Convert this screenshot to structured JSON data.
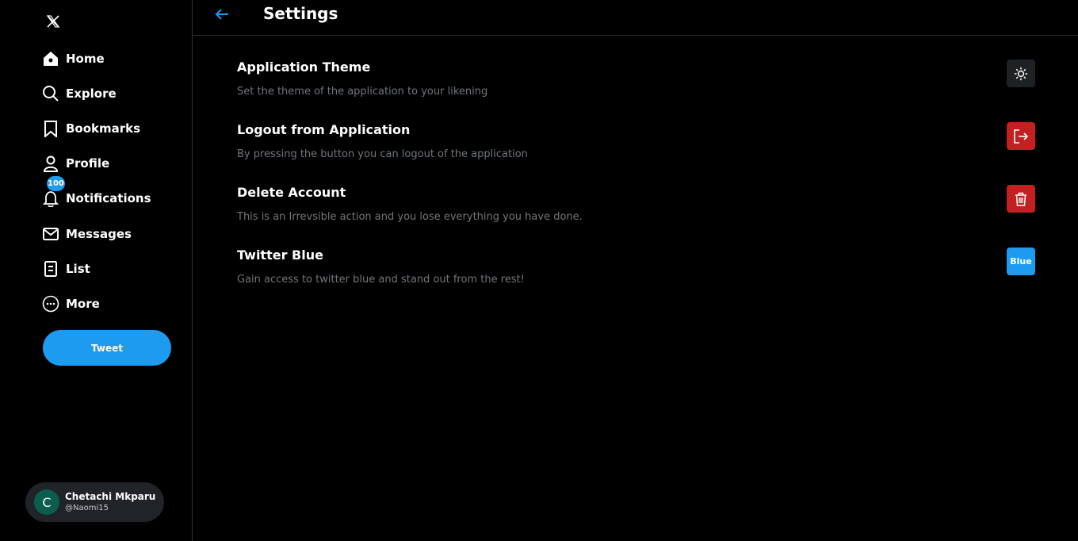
{
  "colors": {
    "accent": "#1d9bf0",
    "danger": "#c22021",
    "neutral_button": "#1f2225",
    "background": "#000000",
    "muted_text": "#71767b"
  },
  "sidebar": {
    "logo_icon": "x-logo-icon",
    "items": [
      {
        "label": "Home",
        "icon": "home-icon"
      },
      {
        "label": "Explore",
        "icon": "search-icon"
      },
      {
        "label": "Bookmarks",
        "icon": "bookmark-icon"
      },
      {
        "label": "Profile",
        "icon": "person-icon"
      },
      {
        "label": "Notifications",
        "icon": "bell-icon",
        "badge": "100"
      },
      {
        "label": "Messages",
        "icon": "envelope-icon"
      },
      {
        "label": "List",
        "icon": "list-icon"
      },
      {
        "label": "More",
        "icon": "more-icon"
      }
    ],
    "tweet_button": "Tweet",
    "account": {
      "avatar_initial": "C",
      "name": "Chetachi Mkparu",
      "handle": "@Naomi15"
    }
  },
  "header": {
    "back_icon": "arrow-left-icon",
    "title": "Settings"
  },
  "settings": [
    {
      "title": "Application Theme",
      "description": "Set the theme of the application to your likening",
      "button_icon": "sun-icon"
    },
    {
      "title": "Logout from Application",
      "description": "By pressing the button you can logout of the application",
      "button_icon": "logout-icon"
    },
    {
      "title": "Delete Account",
      "description": "This is an Irrevsible action and you lose everything you have done.",
      "button_icon": "trash-icon"
    },
    {
      "title": "Twitter Blue",
      "description": "Gain access to twitter blue and stand out from the rest!",
      "button_label": "Blue"
    }
  ]
}
